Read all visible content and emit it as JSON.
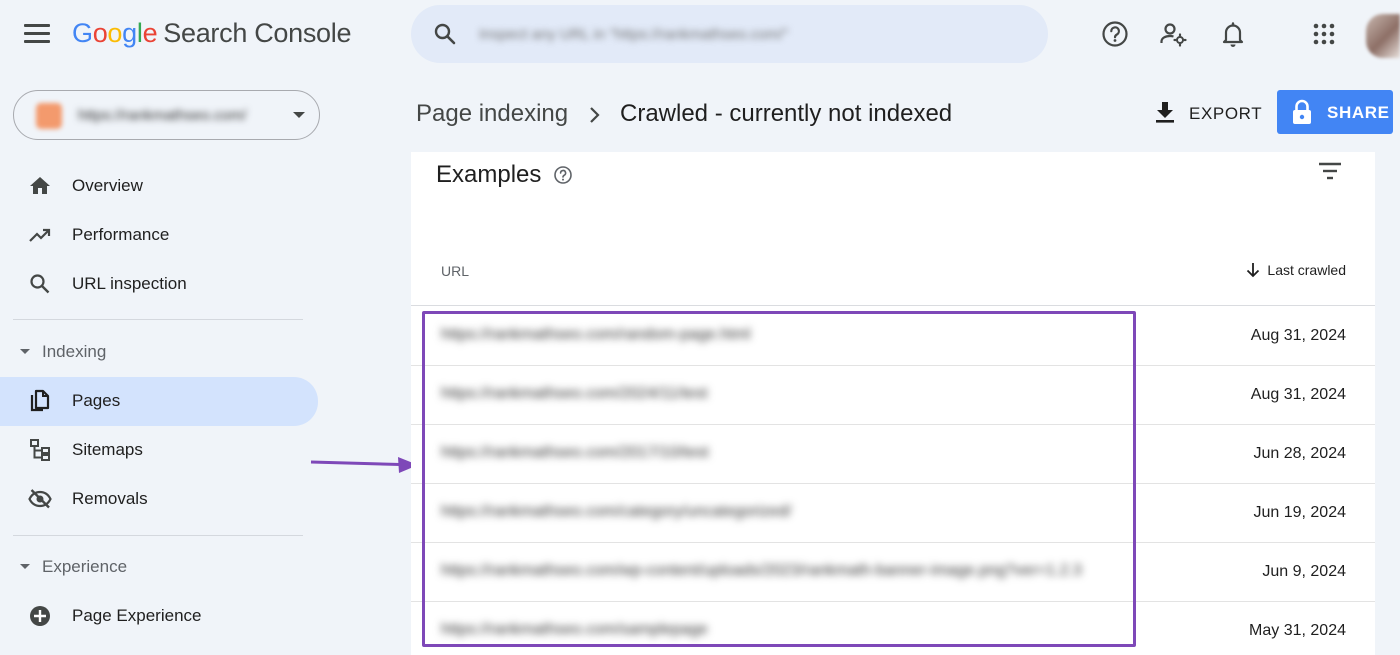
{
  "header": {
    "logo_letters": [
      "G",
      "o",
      "o",
      "g",
      "l",
      "e"
    ],
    "product": "Search Console",
    "search_placeholder": "Inspect any URL in \"https://rankmathseo.com/\"",
    "icons": [
      "help-icon",
      "manage-users-icon",
      "notifications-icon",
      "apps-grid-icon"
    ]
  },
  "property": {
    "name": "https://rankmathseo.com/"
  },
  "sidebar": {
    "items": [
      {
        "label": "Overview",
        "icon": "home-icon"
      },
      {
        "label": "Performance",
        "icon": "trending-up-icon"
      },
      {
        "label": "URL inspection",
        "icon": "search-icon"
      }
    ],
    "sections": [
      {
        "label": "Indexing",
        "items": [
          {
            "label": "Pages",
            "icon": "pages-icon",
            "active": true
          },
          {
            "label": "Sitemaps",
            "icon": "sitemap-icon"
          },
          {
            "label": "Removals",
            "icon": "eye-off-icon"
          }
        ]
      },
      {
        "label": "Experience",
        "items": [
          {
            "label": "Page Experience",
            "icon": "plus-circle-icon"
          }
        ]
      }
    ]
  },
  "breadcrumb": {
    "parent": "Page indexing",
    "current": "Crawled - currently not indexed"
  },
  "actions": {
    "export": "EXPORT",
    "share": "SHARE"
  },
  "examples": {
    "title": "Examples",
    "columns": {
      "url": "URL",
      "last_crawled": "Last crawled"
    },
    "rows": [
      {
        "url": "https://rankmathseo.com/random-page.html",
        "date": "Aug 31, 2024"
      },
      {
        "url": "https://rankmathseo.com/2024/11/test",
        "date": "Aug 31, 2024"
      },
      {
        "url": "https://rankmathseo.com/2017/10/test",
        "date": "Jun 28, 2024"
      },
      {
        "url": "https://rankmathseo.com/category/uncategorized/",
        "date": "Jun 19, 2024"
      },
      {
        "url": "https://rankmathseo.com/wp-content/uploads/2023/rankmath-banner-image.png?ver=1.2.3",
        "date": "Jun 9, 2024"
      },
      {
        "url": "https://rankmathseo.com/samplepage",
        "date": "May 31, 2024"
      }
    ]
  },
  "colors": {
    "accent": "#4285f4",
    "active_nav": "#d3e3fd",
    "highlight_border": "#7e48b8",
    "background": "#f0f4f9"
  }
}
